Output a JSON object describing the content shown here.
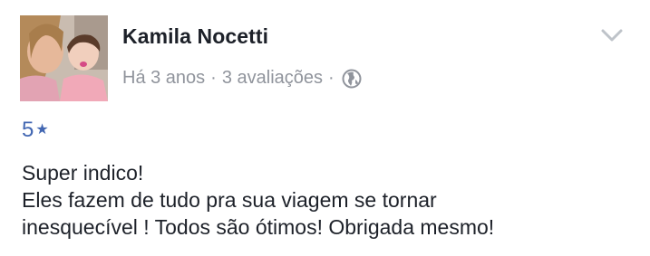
{
  "review": {
    "author": "Kamila Nocetti",
    "time": "Há 3 anos",
    "separator": "·",
    "review_count": "3 avaliações",
    "privacy_icon": "globe-icon",
    "menu_icon": "chevron-down-icon",
    "rating_value": "5",
    "rating_star": "★",
    "text_lines": [
      "Super indico!",
      "Eles fazem de tudo pra sua viagem se tornar",
      "inesquecível ! Todos são ótimos! Obrigada mesmo!"
    ]
  },
  "colors": {
    "name": "#1d2129",
    "meta": "#90949c",
    "rating": "#4267b2"
  }
}
